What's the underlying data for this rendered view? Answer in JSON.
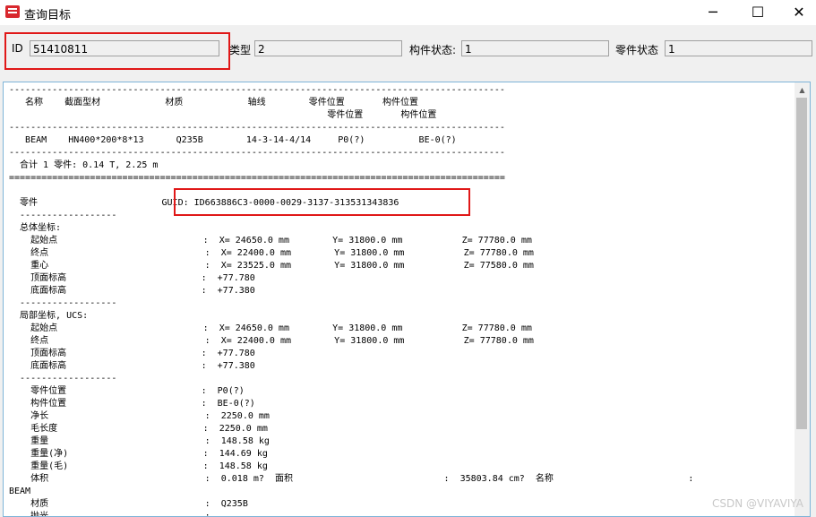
{
  "window": {
    "title": "查询目标",
    "minimize": "─",
    "maximize": "☐",
    "close": "✕"
  },
  "fields": {
    "id_label": "ID",
    "id_value": "51410811",
    "type_label": "类型",
    "type_value": "2",
    "member_status_label": "构件状态:",
    "member_status_value": "1",
    "part_status_label": "零件状态",
    "part_status_value": "1"
  },
  "report": {
    "lines": [
      "--------------------------------------------------------------------------------------------",
      "   名称    截面型材            材质            轴线        零件位置       构件位置",
      "                                                           零件位置       构件位置",
      "--------------------------------------------------------------------------------------------",
      "   BEAM    HN400*200*8*13      Q235B        14-3-14-4/14     P0(?)          BE-0(?)",
      "--------------------------------------------------------------------------------------------",
      "  合计 1 零件: 0.14 T, 2.25 m",
      "============================================================================================",
      "",
      "  零件                       GUID: ID663886C3-0000-0029-3137-313531343836",
      "  ------------------",
      "  总体坐标:",
      "    起始点                           :  X= 24650.0 mm        Y= 31800.0 mm           Z= 77780.0 mm",
      "    终点                             :  X= 22400.0 mm        Y= 31800.0 mm           Z= 77780.0 mm",
      "    重心                             :  X= 23525.0 mm        Y= 31800.0 mm           Z= 77580.0 mm",
      "    顶面标高                         :  +77.780",
      "    底面标高                         :  +77.380",
      "  ------------------",
      "  局部坐标, UCS:",
      "    起始点                           :  X= 24650.0 mm        Y= 31800.0 mm           Z= 77780.0 mm",
      "    终点                             :  X= 22400.0 mm        Y= 31800.0 mm           Z= 77780.0 mm",
      "    顶面标高                         :  +77.780",
      "    底面标高                         :  +77.380",
      "  ------------------",
      "    零件位置                         :  P0(?)",
      "    构件位置                         :  BE-0(?)",
      "    净长                             :  2250.0 mm",
      "    毛长度                           :  2250.0 mm",
      "    重量                             :  148.58 kg",
      "    重量(净)                         :  144.69 kg",
      "    重量(毛)                         :  148.58 kg",
      "    体积                             :  0.018 m?  面积                            :  35803.84 cm?  名称                         :",
      "BEAM",
      "    材质                             :  Q235B",
      "    抛光                             :"
    ]
  },
  "watermark": "CSDN @VIYAVIYA"
}
